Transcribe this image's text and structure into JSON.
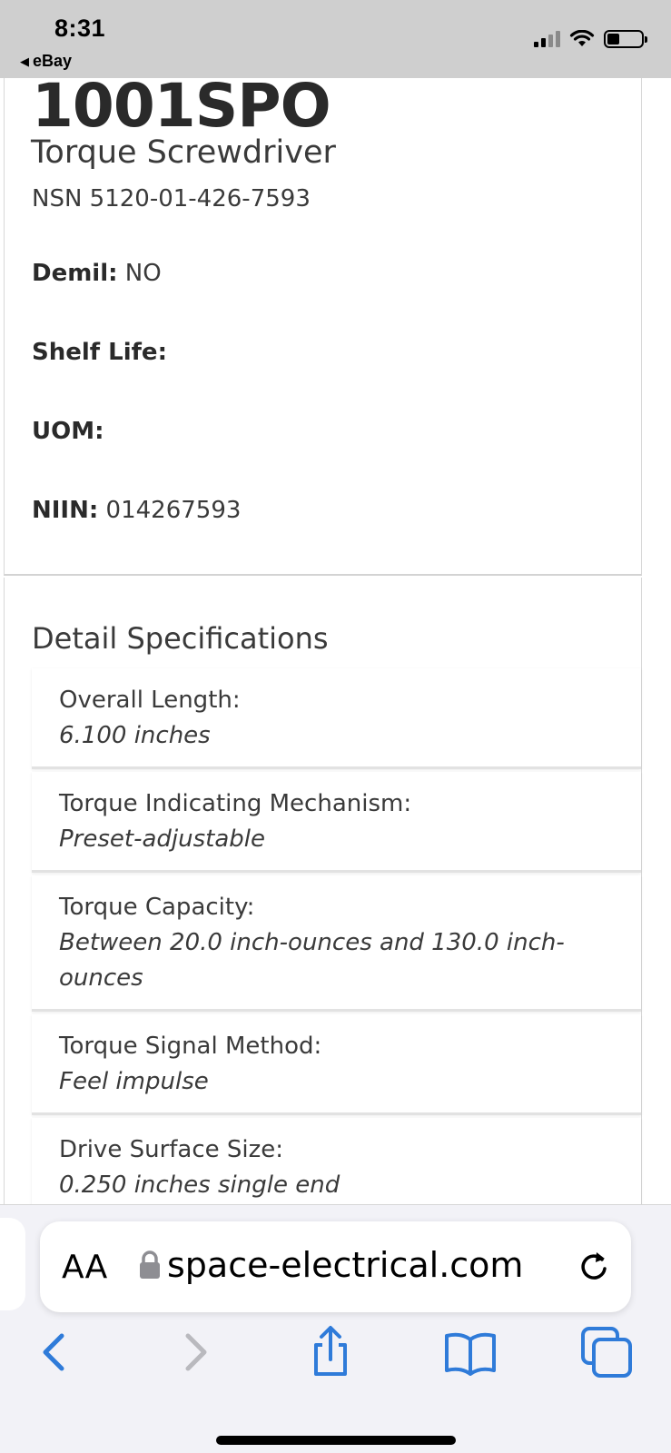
{
  "status_bar": {
    "time": "8:31",
    "back_app": "eBay"
  },
  "product": {
    "part_number": "1001SPO",
    "name": "Torque Screwdriver",
    "nsn": "NSN 5120-01-426-7593",
    "fields": [
      {
        "label": "Demil:",
        "value": "NO"
      },
      {
        "label": "Shelf Life:",
        "value": ""
      },
      {
        "label": "UOM:",
        "value": ""
      },
      {
        "label": "NIIN:",
        "value": "014267593"
      }
    ]
  },
  "details": {
    "title": "Detail Specifications",
    "specs": [
      {
        "label": "Overall Length:",
        "value": "6.100 inches"
      },
      {
        "label": "Torque Indicating Mechanism:",
        "value": "Preset-adjustable"
      },
      {
        "label": "Torque Capacity:",
        "value": "Between 20.0 inch-ounces and 130.0 inch-ounces"
      },
      {
        "label": "Torque Signal Method:",
        "value": "Feel impulse"
      },
      {
        "label": "Drive Surface Size:",
        "value": "0.250 inches single end"
      }
    ]
  },
  "browser": {
    "text_size_label": "AA",
    "url": "space-electrical.com",
    "accent_color": "#2f7bd9"
  }
}
